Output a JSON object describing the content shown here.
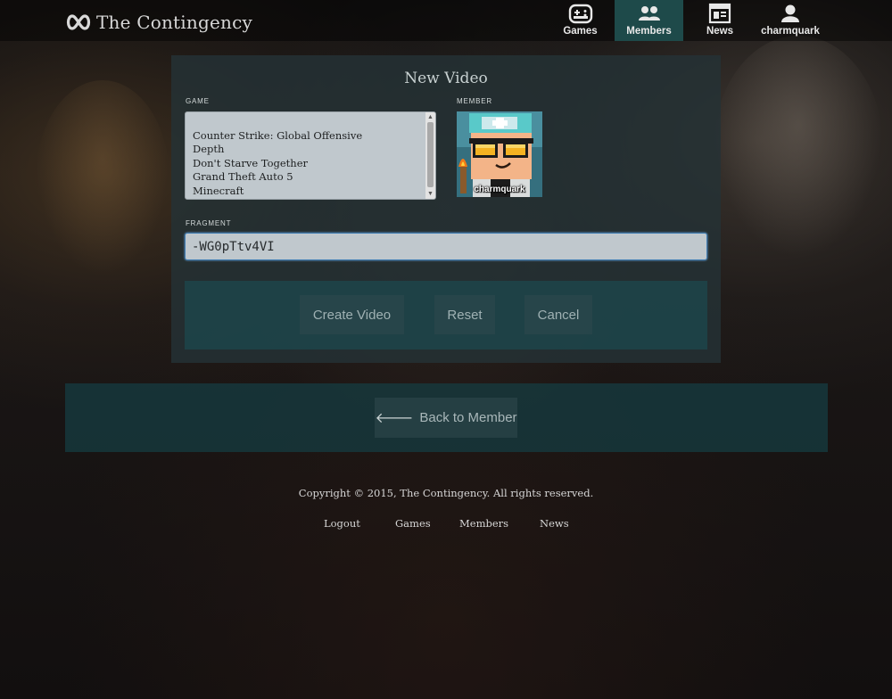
{
  "app": {
    "title": "The Contingency"
  },
  "nav": {
    "games": "Games",
    "members": "Members",
    "news": "News",
    "user": "charmquark",
    "active": "Members"
  },
  "form": {
    "title": "New Video",
    "game_label": "GAME",
    "member_label": "MEMBER",
    "games": [
      "Counter Strike: Global Offensive",
      "Depth",
      "Don't Starve Together",
      "Grand Theft Auto 5",
      "Minecraft"
    ],
    "member_name": "charmquark",
    "fragment_label": "FRAGMENT",
    "fragment_value": "-WG0pTtv4VI",
    "buttons": {
      "create": "Create Video",
      "reset": "Reset",
      "cancel": "Cancel"
    }
  },
  "back": {
    "label": "Back to Member"
  },
  "footer": {
    "copyright": "Copyright © 2015, The Contingency. All rights reserved.",
    "links": [
      "Logout",
      "Games",
      "Members",
      "News"
    ]
  },
  "colors": {
    "accent_teal": "#1e4a4a",
    "panel": "#243236",
    "input_bg": "#c0c8cd",
    "focus_border": "#3d7cb2"
  }
}
